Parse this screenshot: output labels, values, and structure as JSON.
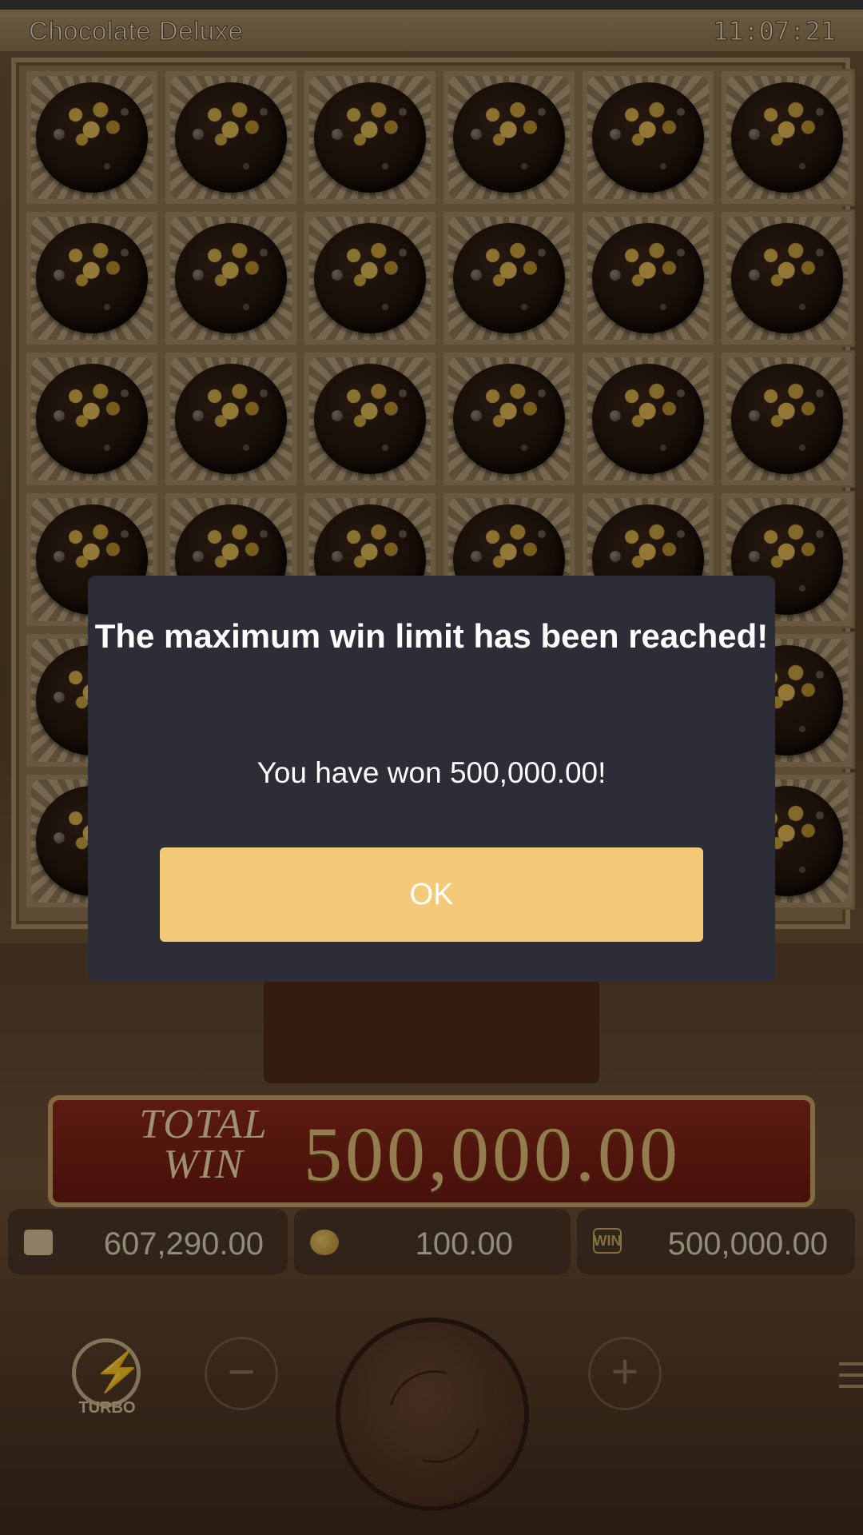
{
  "header": {
    "game_title": "Chocolate Deluxe",
    "clock": "11:07:21"
  },
  "reels": {
    "columns": 6,
    "rows": 6,
    "symbol": "dark-chocolate-truffle"
  },
  "result": {
    "total_label_line1": "TOTAL",
    "total_label_line2": "WIN",
    "total_win": "500,000.00"
  },
  "stats": {
    "balance": "607,290.00",
    "bet": "100.00",
    "win": "500,000.00",
    "win_badge": "WIN"
  },
  "controls": {
    "turbo_label": "TURBO",
    "minus": "−",
    "plus": "+"
  },
  "dialog": {
    "title": "The maximum win limit has been reached!",
    "message": "You have won 500,000.00!",
    "ok_label": "OK",
    "ok_color": "#f4c978",
    "background": "#2d2d38"
  }
}
